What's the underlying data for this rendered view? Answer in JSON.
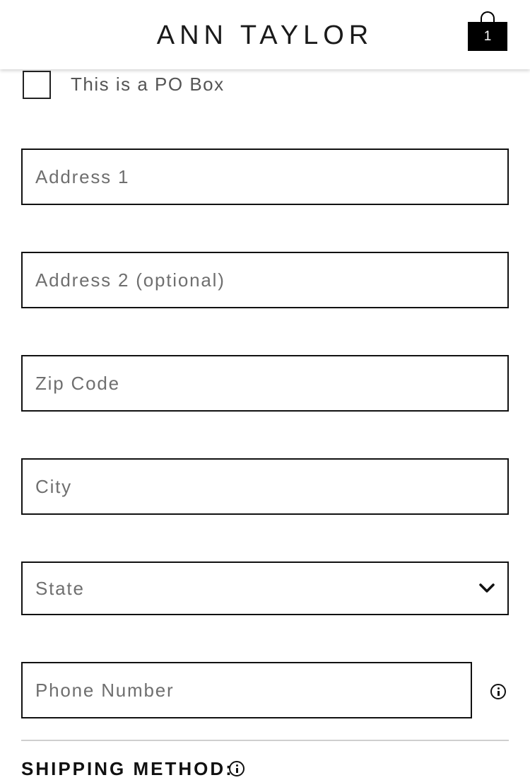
{
  "header": {
    "brand": "ANN TAYLOR",
    "bag_count": "1"
  },
  "form": {
    "po_box_label": "This is a PO Box",
    "po_box_checked": false,
    "address1_placeholder": "Address 1",
    "address2_placeholder": "Address 2 (optional)",
    "zip_placeholder": "Zip Code",
    "city_placeholder": "City",
    "state_selected": "State",
    "phone_placeholder": "Phone Number"
  },
  "shipping": {
    "title": "SHIPPING METHOD:"
  },
  "icons": {
    "bag": "shopping-bag-icon",
    "chevron": "chevron-down-icon",
    "info": "info-icon"
  },
  "colors": {
    "text": "#222222",
    "placeholder": "#6f6f6f",
    "border": "#111111",
    "divider": "#cfcfcf",
    "bag_fill": "#000000"
  }
}
